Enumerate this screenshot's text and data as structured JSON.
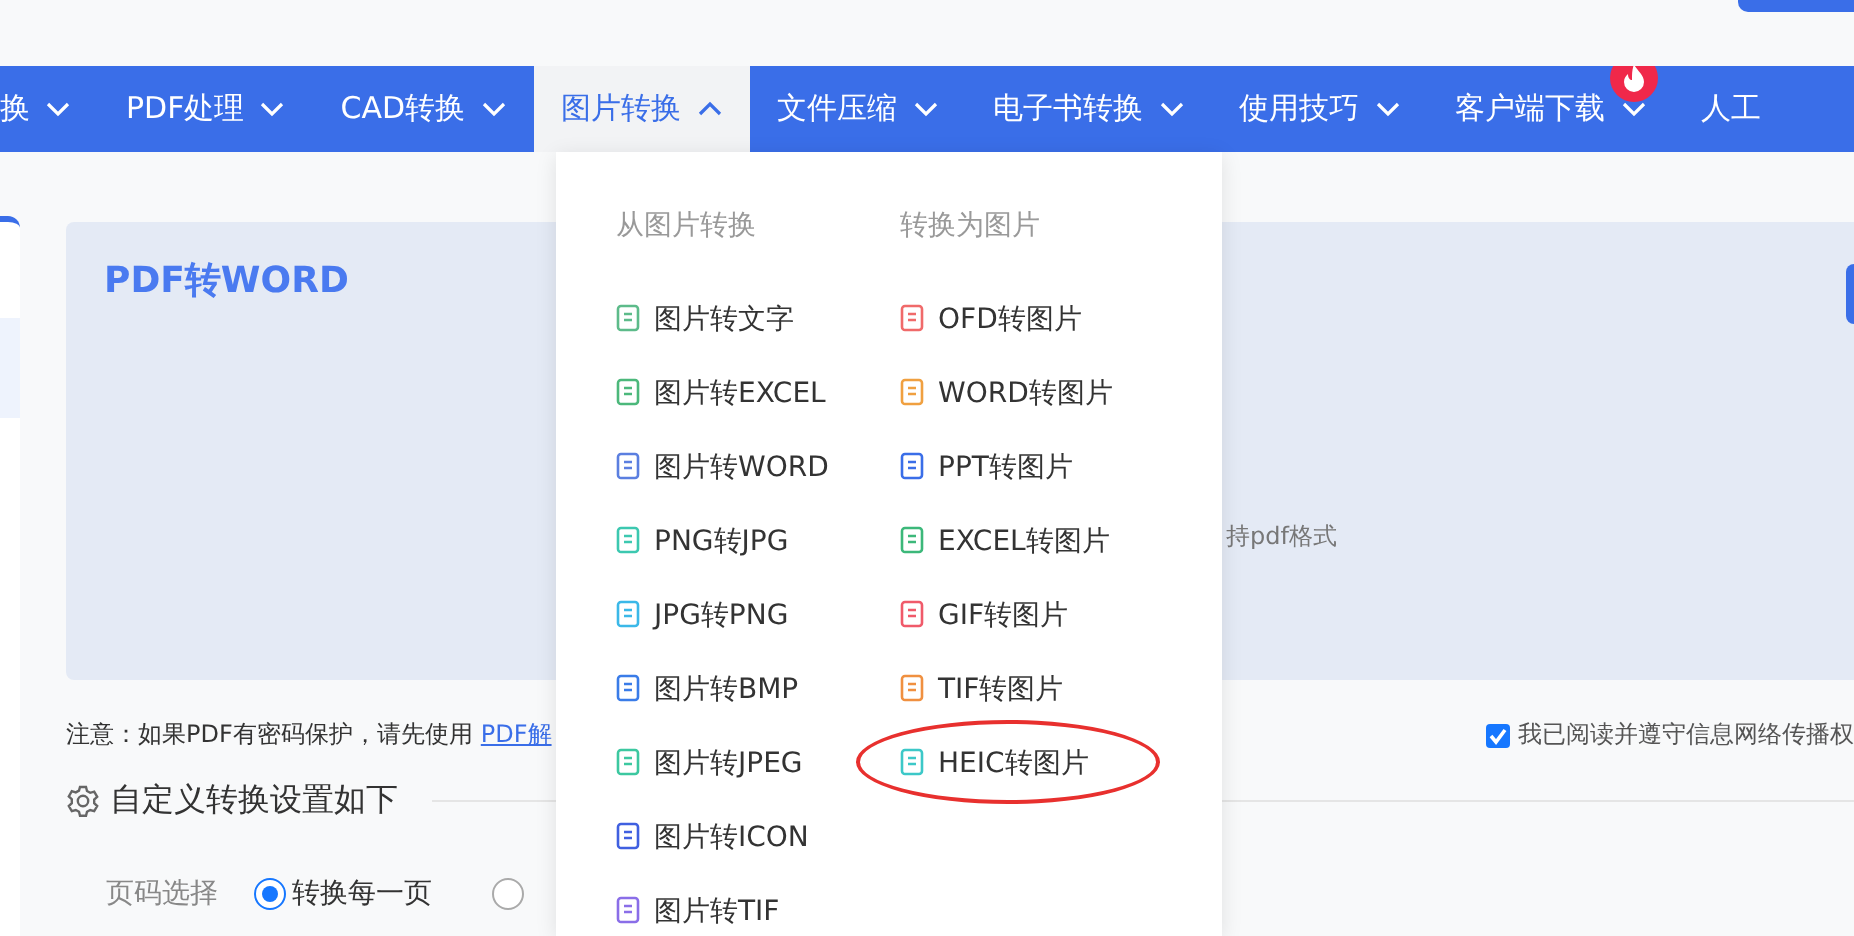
{
  "nav": {
    "items": [
      {
        "label": "换",
        "kind": "dropdown",
        "selected": false,
        "hot": false
      },
      {
        "label": "PDF处理",
        "kind": "dropdown",
        "selected": false,
        "hot": false
      },
      {
        "label": "CAD转换",
        "kind": "dropdown",
        "selected": false,
        "hot": false
      },
      {
        "label": "图片转换",
        "kind": "dropdown",
        "selected": true,
        "hot": false
      },
      {
        "label": "文件压缩",
        "kind": "dropdown",
        "selected": false,
        "hot": false
      },
      {
        "label": "电子书转换",
        "kind": "dropdown",
        "selected": false,
        "hot": false
      },
      {
        "label": "使用技巧",
        "kind": "dropdown",
        "selected": false,
        "hot": false
      },
      {
        "label": "客户端下载",
        "kind": "dropdown",
        "selected": false,
        "hot": true
      },
      {
        "label": "人工",
        "kind": "link",
        "selected": false,
        "hot": false
      }
    ]
  },
  "dropdown": {
    "columns": [
      {
        "heading": "从图片转换",
        "items": [
          {
            "label": "图片转文字",
            "color": "#5dbb8a",
            "circled": false
          },
          {
            "label": "图片转EXCEL",
            "color": "#4cb87b",
            "circled": false
          },
          {
            "label": "图片转WORD",
            "color": "#5b7fe0",
            "circled": false
          },
          {
            "label": "PNG转JPG",
            "color": "#3cc8b0",
            "circled": false
          },
          {
            "label": "JPG转PNG",
            "color": "#3bb8e8",
            "circled": false
          },
          {
            "label": "图片转BMP",
            "color": "#3a7ce8",
            "circled": false
          },
          {
            "label": "图片转JPEG",
            "color": "#3cc8a0",
            "circled": false
          },
          {
            "label": "图片转ICON",
            "color": "#4060e0",
            "circled": false
          },
          {
            "label": "图片转TIF",
            "color": "#8a6ee8",
            "circled": false
          }
        ]
      },
      {
        "heading": "转换为图片",
        "items": [
          {
            "label": "OFD转图片",
            "color": "#f06a6a",
            "circled": false
          },
          {
            "label": "WORD转图片",
            "color": "#f0a040",
            "circled": false
          },
          {
            "label": "PPT转图片",
            "color": "#3a6ee8",
            "circled": false
          },
          {
            "label": "EXCEL转图片",
            "color": "#3cb87a",
            "circled": false
          },
          {
            "label": "GIF转图片",
            "color": "#f05a6a",
            "circled": false
          },
          {
            "label": "TIF转图片",
            "color": "#f09040",
            "circled": false
          },
          {
            "label": "HEIC转图片",
            "color": "#3cc8c8",
            "circled": true
          }
        ]
      }
    ]
  },
  "upload": {
    "title": "PDF转WORD",
    "hint": "持pdf格式"
  },
  "note": {
    "text": "注意：如果PDF有密码保护，请先使用",
    "link": "PDF解"
  },
  "agree": {
    "label": "我已阅读并遵守信息网络传播权",
    "checked": true
  },
  "settings": {
    "title": "自定义转换设置如下",
    "fields": [
      {
        "label": "页码选择",
        "options": [
          {
            "label": "转换每一页",
            "selected": true
          },
          {
            "selected": false
          }
        ]
      }
    ]
  }
}
